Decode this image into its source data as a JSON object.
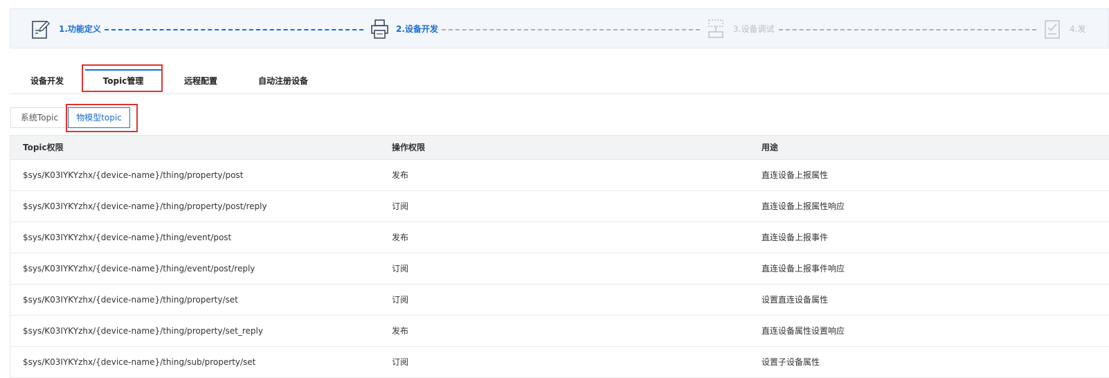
{
  "stepper": {
    "steps": [
      {
        "label": "1.功能定义",
        "icon": "edit-document-icon",
        "state": "active"
      },
      {
        "label": "2.设备开发",
        "icon": "printer-icon",
        "state": "active"
      },
      {
        "label": "3.设备调试",
        "icon": "debug-monitor-icon",
        "state": "inactive"
      },
      {
        "label": "4.发",
        "icon": "checklist-icon",
        "state": "inactive"
      }
    ],
    "colors": {
      "active": "#1b6ed1",
      "inactive": "#b8bfca"
    }
  },
  "tabs": {
    "items": [
      {
        "label": "设备开发"
      },
      {
        "label": "Topic管理"
      },
      {
        "label": "远程配置"
      },
      {
        "label": "自动注册设备"
      }
    ],
    "active_index": 1
  },
  "subtabs": {
    "items": [
      {
        "label": "系统Topic"
      },
      {
        "label": "物模型topic"
      }
    ],
    "active_index": 1
  },
  "table": {
    "headers": [
      "Topic权限",
      "操作权限",
      "用途"
    ],
    "rows": [
      [
        "$sys/K03IYKYzhx/{device-name}/thing/property/post",
        "发布",
        "直连设备上报属性"
      ],
      [
        "$sys/K03IYKYzhx/{device-name}/thing/property/post/reply",
        "订阅",
        "直连设备上报属性响应"
      ],
      [
        "$sys/K03IYKYzhx/{device-name}/thing/event/post",
        "发布",
        "直连设备上报事件"
      ],
      [
        "$sys/K03IYKYzhx/{device-name}/thing/event/post/reply",
        "订阅",
        "直连设备上报事件响应"
      ],
      [
        "$sys/K03IYKYzhx/{device-name}/thing/property/set",
        "订阅",
        "设置直连设备属性"
      ],
      [
        "$sys/K03IYKYzhx/{device-name}/thing/property/set_reply",
        "发布",
        "直连设备属性设置响应"
      ],
      [
        "$sys/K03IYKYzhx/{device-name}/thing/sub/property/set",
        "订阅",
        "设置子设备属性"
      ]
    ]
  },
  "highlight_color": "#e03131"
}
